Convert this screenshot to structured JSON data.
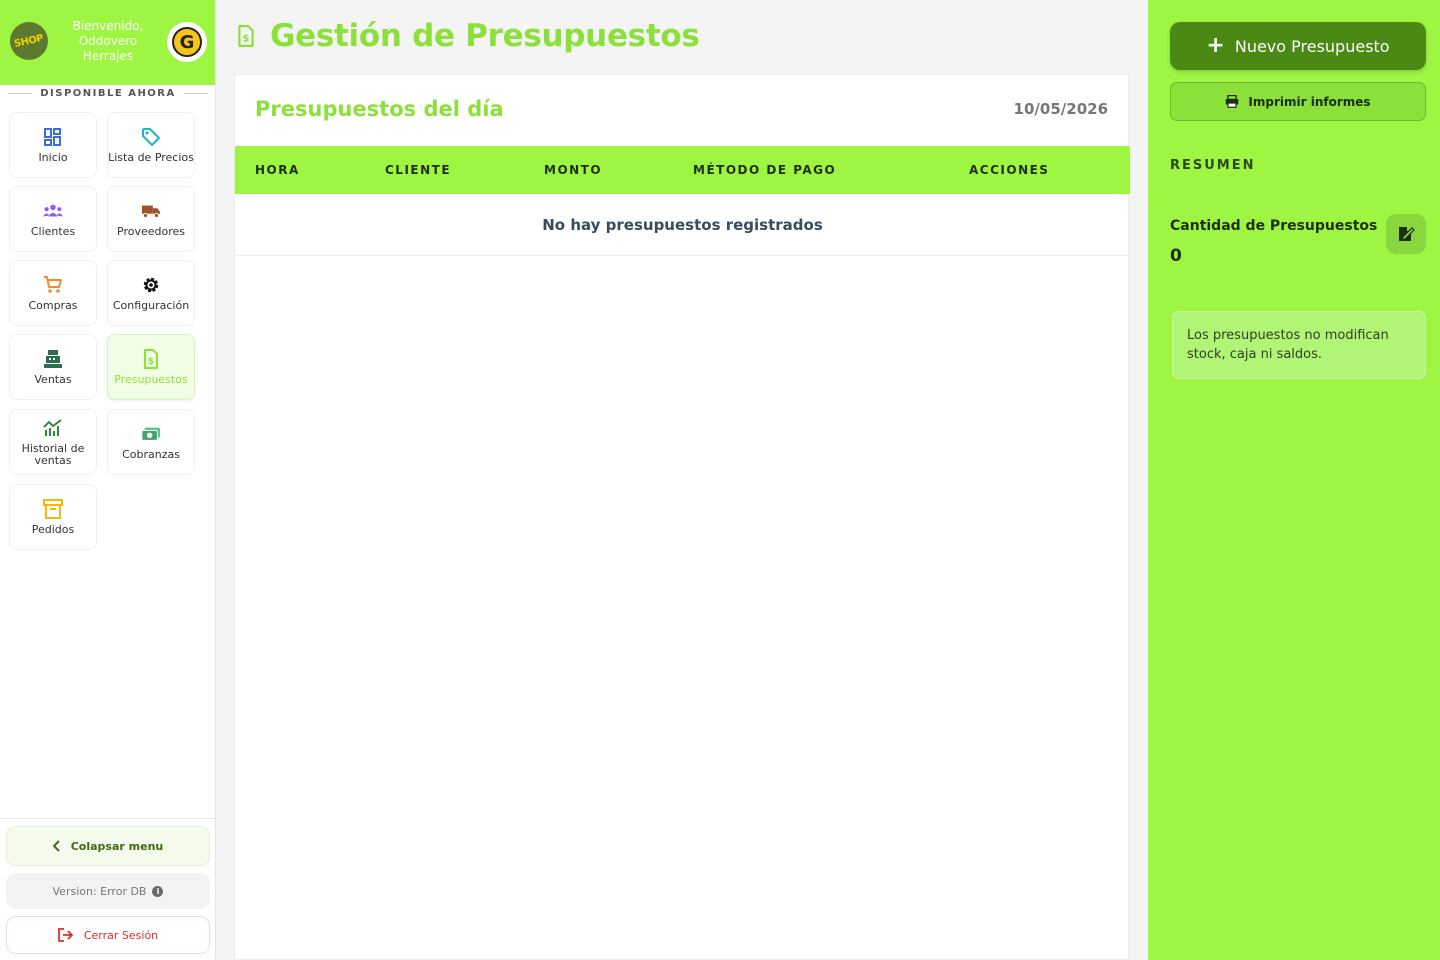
{
  "sidebar": {
    "brand_logo_text": "SHOP",
    "welcome": "Bienvenido, Oddovero Herrajes",
    "section_label": "DISPONIBLE AHORA",
    "items": [
      {
        "label": "Inicio"
      },
      {
        "label": "Lista de Precios"
      },
      {
        "label": "Clientes"
      },
      {
        "label": "Proveedores"
      },
      {
        "label": "Compras"
      },
      {
        "label": "Configuración"
      },
      {
        "label": "Ventas"
      },
      {
        "label": "Presupuestos"
      },
      {
        "label": "Historial de ventas"
      },
      {
        "label": "Cobranzas"
      },
      {
        "label": "Pedidos"
      }
    ],
    "collapse_label": "Colapsar menu",
    "version_label": "Version: Error DB",
    "logout_label": "Cerrar Sesión"
  },
  "main": {
    "page_title": "Gestión de Presupuestos",
    "card_title": "Presupuestos del día",
    "date": "10/05/2026",
    "columns": [
      "HORA",
      "CLIENTE",
      "MONTO",
      "MÉTODO DE PAGO",
      "ACCIONES"
    ],
    "empty_message": "No hay presupuestos registrados"
  },
  "right_panel": {
    "new_button": "Nuevo Presupuesto",
    "print_button": "Imprimir informes",
    "summary_title": "RESUMEN",
    "count_label": "Cantidad de Presupuestos",
    "count_value": "0",
    "note": "Los presupuestos no modifican stock, caja ni saldos."
  },
  "colors": {
    "accent": "#9ef542",
    "accent_text": "#8ce03a",
    "dark_green": "#4a8a14",
    "logout_red": "#d9302f"
  },
  "icons": {
    "inicio": "dashboard-icon",
    "lista": "tag-icon",
    "clientes": "users-icon",
    "proveedores": "truck-icon",
    "compras": "cart-icon",
    "configuracion": "gear-icon",
    "ventas": "cash-register-icon",
    "presupuestos": "invoice-icon",
    "historial": "chart-icon",
    "cobranzas": "money-icon",
    "pedidos": "archive-icon"
  }
}
